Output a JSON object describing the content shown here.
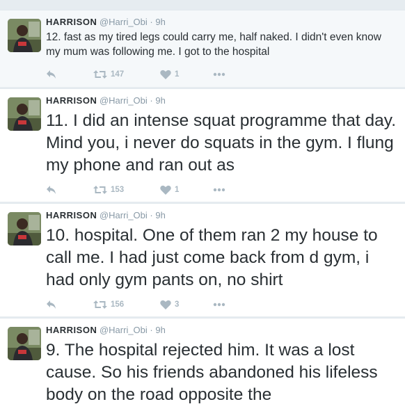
{
  "tweets": [
    {
      "name": "HARRISON",
      "handle": "@Harri_Obi",
      "time": "9h",
      "text": "12. fast as my tired legs could carry me, half naked. I didn't even know my mum was following me. I got to the hospital",
      "retweets": "147",
      "likes": "1"
    },
    {
      "name": "HARRISON",
      "handle": "@Harri_Obi",
      "time": "9h",
      "text": "11. I did an intense squat programme that day. Mind you, i never do squats in the gym. I flung my phone and ran out as",
      "retweets": "153",
      "likes": "1"
    },
    {
      "name": "HARRISON",
      "handle": "@Harri_Obi",
      "time": "9h",
      "text": "10. hospital. One of them ran 2 my house to call me. I had just come back from d gym, i had only gym pants on, no shirt",
      "retweets": "156",
      "likes": "3"
    },
    {
      "name": "HARRISON",
      "handle": "@Harri_Obi",
      "time": "9h",
      "text": "9. The hospital rejected him. It was a lost cause. So his friends abandoned his lifeless body on the road opposite the",
      "retweets": "",
      "likes": ""
    }
  ],
  "separator": "·",
  "icons": {
    "reply": "reply-icon",
    "retweet": "retweet-icon",
    "like": "heart-icon",
    "more": "more-icon"
  },
  "colors": {
    "text": "#292f33",
    "meta": "#8899a6",
    "action": "#aab8c2",
    "background": "#e6ecf0",
    "highlight": "#f5f8fa"
  }
}
